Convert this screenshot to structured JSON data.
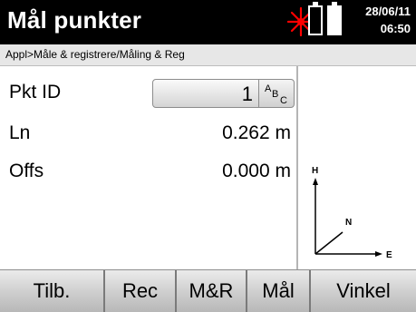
{
  "header": {
    "title": "Mål punkter",
    "date": "28/06/11",
    "time": "06:50",
    "icons": [
      "laser-icon",
      "battery-icon",
      "battery-icon"
    ],
    "colors": {
      "laser": "#ff0000",
      "background": "#000000"
    }
  },
  "breadcrumb": "Appl>Måle & registrere/Måling & Reg",
  "fields": {
    "pkt_id": {
      "label": "Pkt ID",
      "value": "1",
      "input_mode": "ABC"
    },
    "ln": {
      "label": "Ln",
      "value": "0.262 m"
    },
    "offs": {
      "label": "Offs",
      "value": "0.000 m"
    }
  },
  "diagram": {
    "axes": [
      "H",
      "N",
      "E"
    ]
  },
  "softkeys": [
    "Tilb.",
    "Rec",
    "M&R",
    "Mål",
    "Vinkel"
  ]
}
